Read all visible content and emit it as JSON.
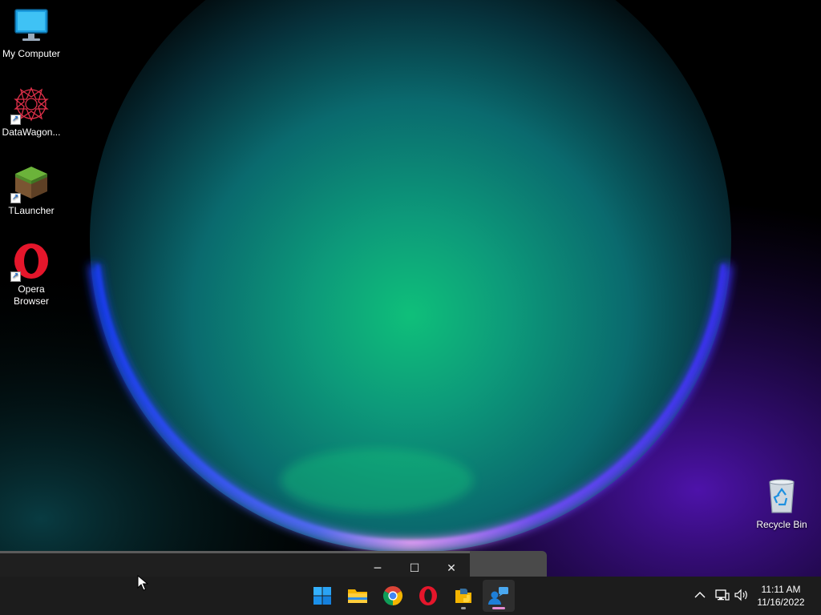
{
  "desktop": {
    "icons": [
      {
        "label": "My Computer",
        "icon": "monitor-icon",
        "shortcut": false
      },
      {
        "label": "DataWagon...",
        "icon": "datawagon-icon",
        "shortcut": true
      },
      {
        "label": "TLauncher",
        "icon": "minecraft-grass-block-icon",
        "shortcut": true
      },
      {
        "label": "Opera Browser",
        "icon": "opera-icon",
        "shortcut": true
      },
      {
        "label": "Recycle Bin",
        "icon": "recycle-bin-icon",
        "shortcut": false
      }
    ]
  },
  "preview_window": {
    "controls": {
      "minimize": "─",
      "maximize": "☐",
      "close": "✕"
    }
  },
  "taskbar": {
    "apps": [
      {
        "name": "start",
        "icon": "windows-start-icon"
      },
      {
        "name": "file-explorer",
        "icon": "folder-icon"
      },
      {
        "name": "chrome",
        "icon": "chrome-icon"
      },
      {
        "name": "opera",
        "icon": "opera-icon"
      },
      {
        "name": "python-app",
        "icon": "python-icon",
        "running": true
      },
      {
        "name": "remote-app",
        "icon": "remote-user-icon",
        "active": true
      }
    ],
    "tray": {
      "chevron": "^",
      "network_icon": "network-icon",
      "volume_icon": "volume-icon"
    },
    "clock": {
      "time": "11:11 AM",
      "date": "11/16/2022"
    }
  },
  "colors": {
    "taskbar_bg": "#1c1c1c",
    "active_indicator": "#e58bd1",
    "running_indicator": "#9a9a9a"
  }
}
